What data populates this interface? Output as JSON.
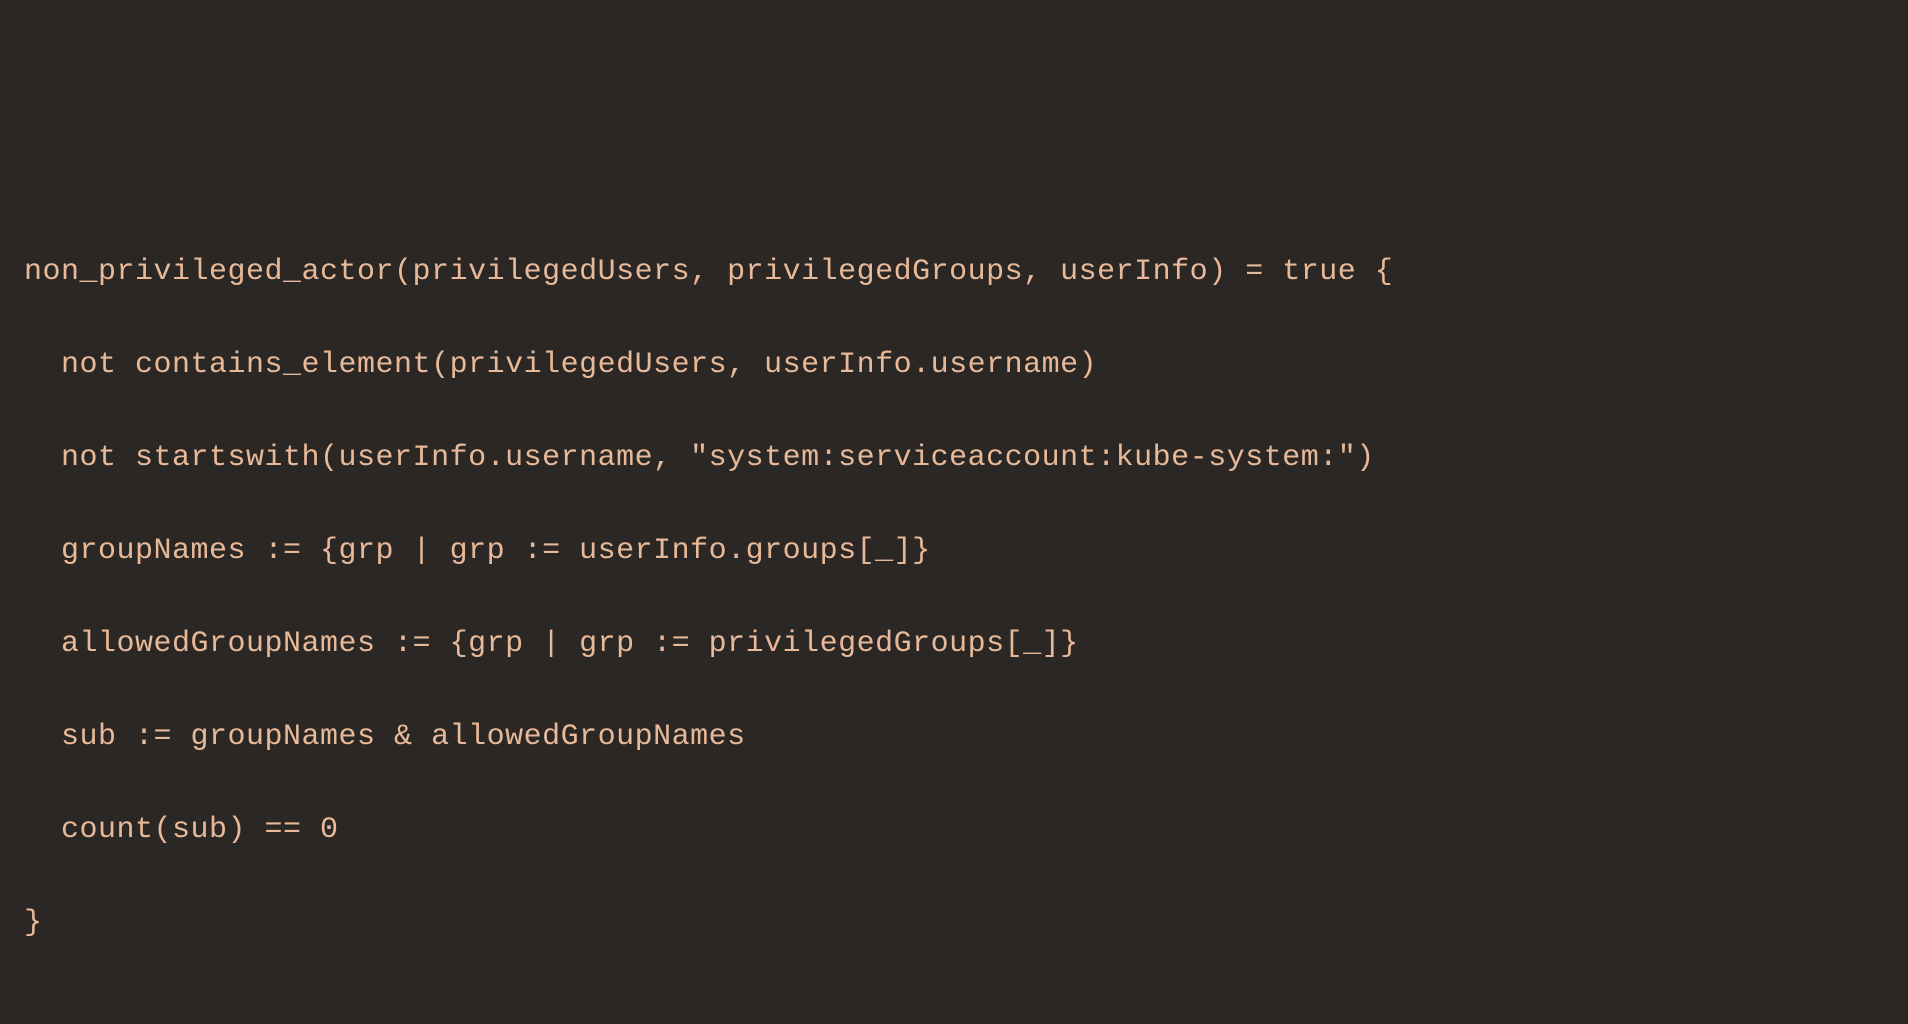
{
  "code": {
    "line1": "non_privileged_actor(privilegedUsers, privilegedGroups, userInfo) = true {",
    "line2": "  not contains_element(privilegedUsers, userInfo.username)",
    "line3": "  not startswith(userInfo.username, \"system:serviceaccount:kube-system:\")",
    "line4": "  groupNames := {grp | grp := userInfo.groups[_]}",
    "line5": "  allowedGroupNames := {grp | grp := privilegedGroups[_]}",
    "line6": "  sub := groupNames & allowedGroupNames",
    "line7": "  count(sub) == 0",
    "line8": "}"
  }
}
